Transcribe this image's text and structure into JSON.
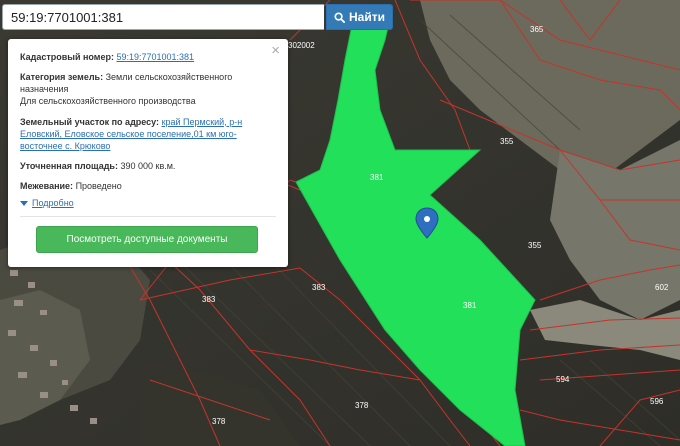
{
  "search": {
    "value": "59:19:7701001:381",
    "button_label": "Найти",
    "button_icon": "search-icon"
  },
  "popup": {
    "close_glyph": "×",
    "cadastral_label": "Кадастровый номер:",
    "cadastral_value": "59:19:7701001:381",
    "category_label": "Категория земель:",
    "category_value": "Земли сельскохозяйственного назначения",
    "usage_value": "Для сельскохозяйственного производства",
    "address_label": "Земельный участок по адресу:",
    "address_value": "край Пермский, р-н Еловский, Еловское сельское поселение,01 км юго-восточнее с. Крюково",
    "area_label": "Уточненная площадь:",
    "area_value": "390 000 кв.м.",
    "survey_label": "Межевание:",
    "survey_value": "Проведено",
    "more_label": "Подробно",
    "docs_button_label": "Посмотреть доступные документы"
  },
  "map": {
    "parcel_labels": {
      "p365": "365",
      "p381_top": "381",
      "p381_bottom": "381",
      "p355_a": "355",
      "p355_b": "355",
      "p383_a": "383",
      "p383_b": "383",
      "p378_a": "378",
      "p378_b": "378",
      "p594": "594",
      "p596": "596",
      "p602": "602",
      "block_top": "302002"
    },
    "selected_parcel_color": "#22e05a",
    "boundary_color": "#c5342a",
    "marker_color": "#2f6fc0"
  }
}
